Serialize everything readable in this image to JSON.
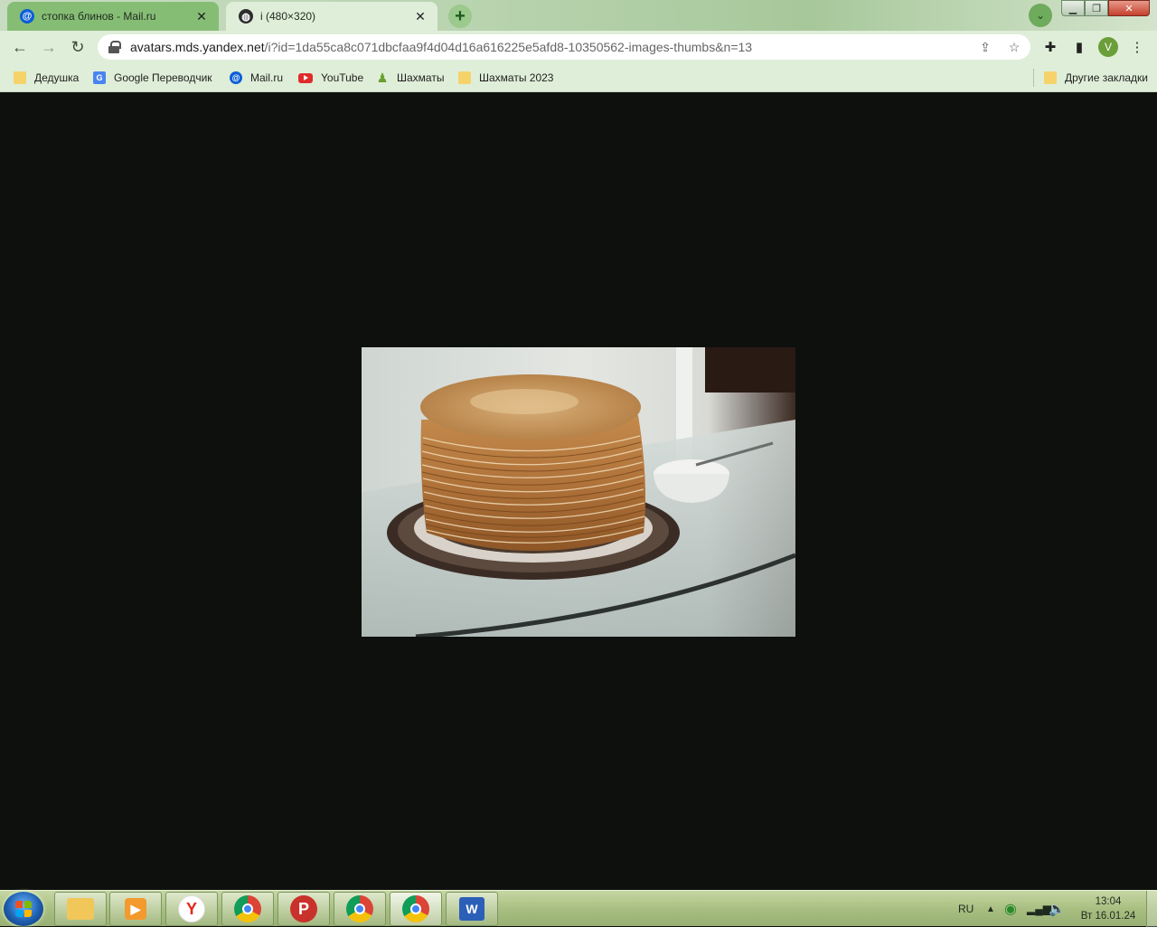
{
  "tabs": [
    {
      "title": "стопка блинов - Mail.ru",
      "favicon": "mailru-icon",
      "active": false
    },
    {
      "title": "i (480×320)",
      "favicon": "globe-icon",
      "active": true
    }
  ],
  "toolbar": {
    "url_host": "avatars.mds.yandex.net",
    "url_path": "/i?id=1da55ca8c071dbcfaa9f4d04d16a616225e5afd8-10350562-images-thumbs&n=13",
    "profile_initial": "V"
  },
  "bookmarks": [
    {
      "label": "Дедушка",
      "icon": "folder-icon"
    },
    {
      "label": "Google Переводчик",
      "icon": "google-translate-icon"
    },
    {
      "label": "Mail.ru",
      "icon": "mailru-icon"
    },
    {
      "label": "YouTube",
      "icon": "youtube-icon"
    },
    {
      "label": "Шахматы",
      "icon": "chess-pawn-icon"
    },
    {
      "label": "Шахматы 2023",
      "icon": "folder-icon"
    },
    {
      "label": "Другие закладки",
      "icon": "folder-icon"
    }
  ],
  "image": {
    "subject": "stack of pancakes on a plate",
    "natural_width": 480,
    "natural_height": 320
  },
  "taskbar": {
    "pinned": [
      "explorer-icon",
      "media-player-icon",
      "yandex-browser-icon",
      "chrome-icon",
      "p-app-icon",
      "chrome-profile-icon",
      "chrome-profile-v-icon",
      "word-icon"
    ],
    "language": "RU",
    "time": "13:04",
    "date": "Вт 16.01.24"
  },
  "colors": {
    "chrome_frame": "#dfeed8",
    "inactive_tab": "#86bd75",
    "page_background": "#0e100e"
  }
}
